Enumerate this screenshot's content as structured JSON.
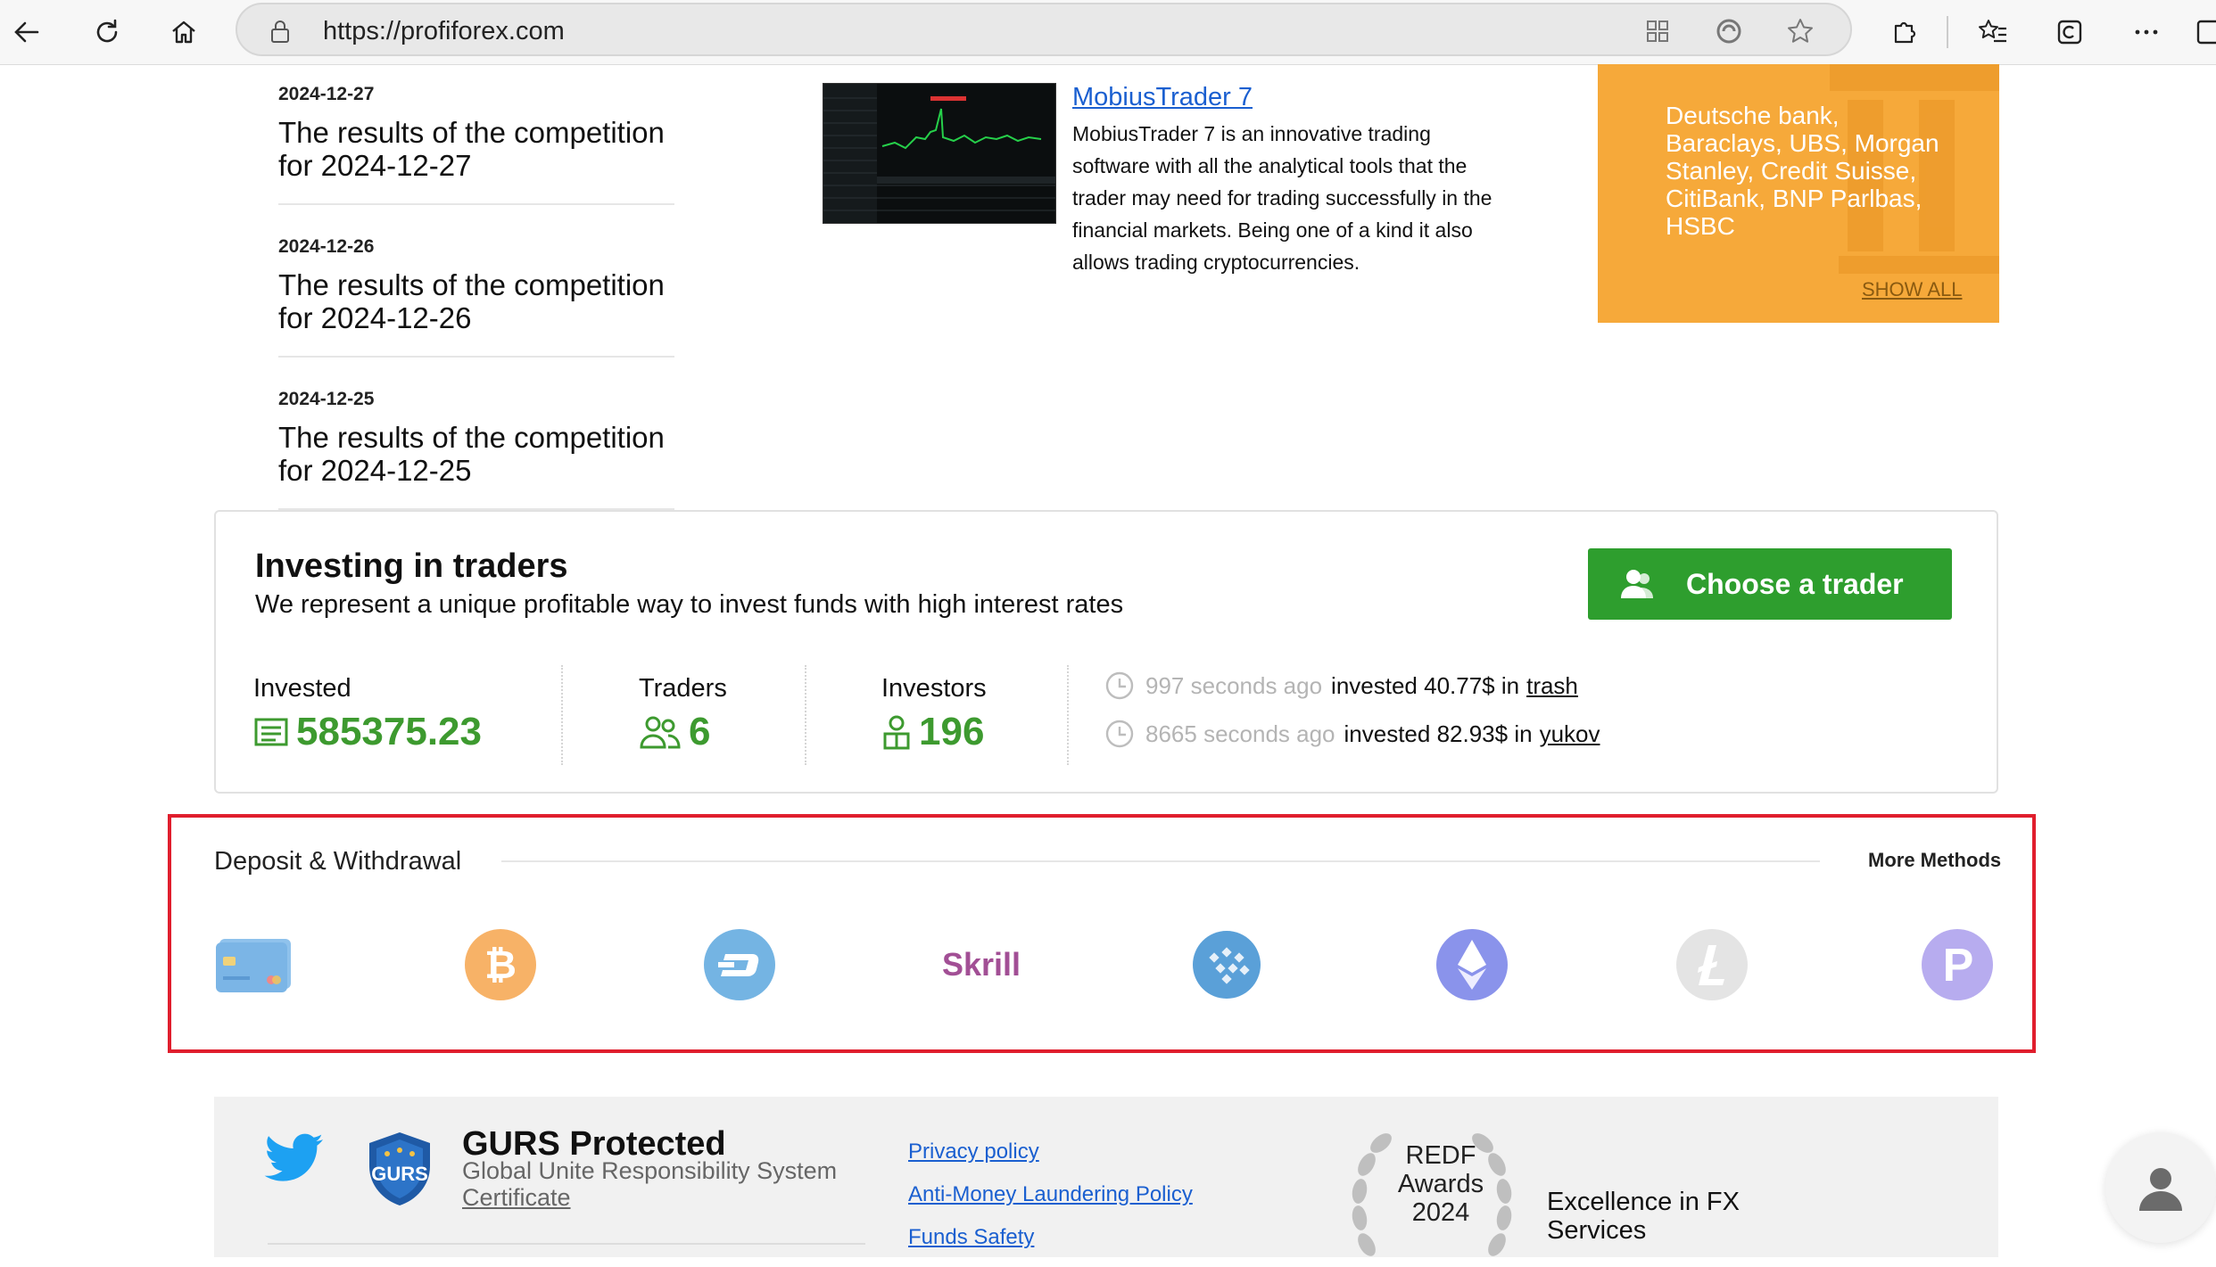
{
  "browser": {
    "url": "https://profiforex.com"
  },
  "news": [
    {
      "date": "2024-12-27",
      "title": "The results of the competition for 2024-12-27"
    },
    {
      "date": "2024-12-26",
      "title": "The results of the competition for 2024-12-26"
    },
    {
      "date": "2024-12-25",
      "title": "The results of the competition for 2024-12-25"
    }
  ],
  "product": {
    "title": "MobiusTrader 7",
    "description": "MobiusTrader 7 is an innovative trading software with all the analytical tools that the trader may need for trading successfully in the financial markets. Being one of a kind it also allows trading cryptocurrencies."
  },
  "banner": {
    "text": "Deutsche bank, Baraclays, UBS, Morgan Stanley, Credit Suisse, CitiBank, BNP Parlbas, HSBC",
    "link": "SHOW ALL"
  },
  "invest": {
    "title": "Investing in traders",
    "subtitle": "We represent a unique profitable way to invest funds with high interest rates",
    "button": "Choose a trader",
    "stats": {
      "invested_label": "Invested",
      "invested_value": "585375.23",
      "traders_label": "Traders",
      "traders_value": "6",
      "investors_label": "Investors",
      "investors_value": "196"
    },
    "feed": [
      {
        "ago": "997 seconds ago",
        "action": "invested 40.77$ in",
        "user": "trash"
      },
      {
        "ago": "8665 seconds ago",
        "action": "invested 82.93$ in",
        "user": "yukov"
      }
    ]
  },
  "payments": {
    "title": "Deposit & Withdrawal",
    "more": "More Methods",
    "skrill_label": "Skrill",
    "methods": [
      "card",
      "bitcoin",
      "dash",
      "skrill",
      "webmoney",
      "ethereum",
      "litecoin",
      "perfect-money"
    ]
  },
  "footer": {
    "gurs_title": "GURS Protected",
    "gurs_subtitle": "Global Unite Responsibility System",
    "gurs_link": "Certificate",
    "gurs_badge": "GURS",
    "links": [
      "Privacy policy",
      "Anti-Money Laundering Policy",
      "Funds Safety"
    ],
    "award_line1": "REDF",
    "award_line2": "Awards",
    "award_year": "2024",
    "award_caption": "Excellence in FX Services"
  }
}
